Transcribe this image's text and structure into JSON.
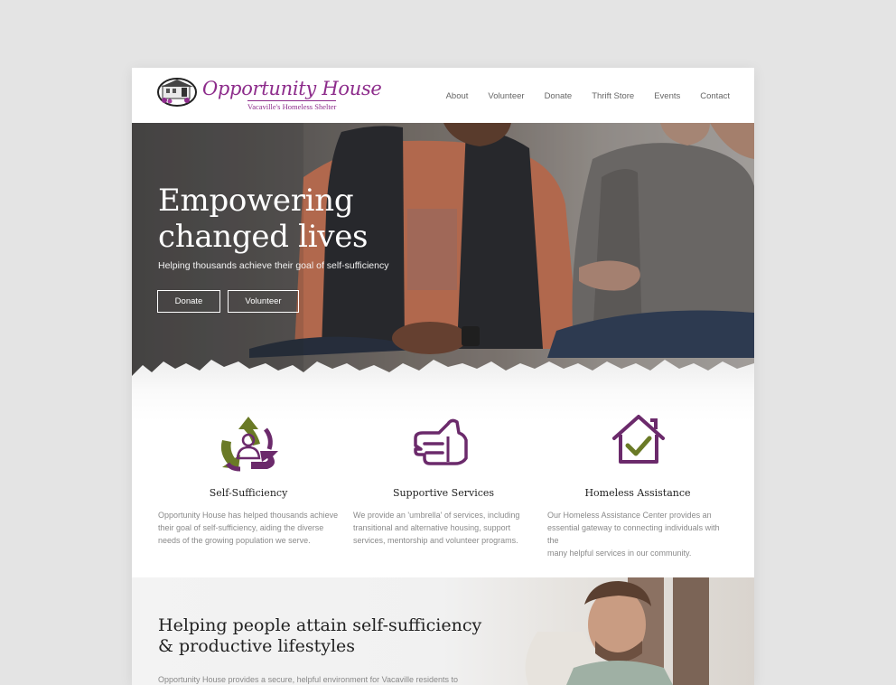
{
  "brand": {
    "name": "Opportunity House",
    "tagline": "Vacaville's Homeless Shelter",
    "accent_color": "#8d2c8b",
    "green_color": "#6a7a26"
  },
  "nav": {
    "items": [
      "About",
      "Volunteer",
      "Donate",
      "Thrift Store",
      "Events",
      "Contact"
    ]
  },
  "hero": {
    "title_line1": "Empowering",
    "title_line2": "changed lives",
    "subtitle": "Helping thousands achieve their goal of self-sufficiency",
    "donate_label": "Donate",
    "volunteer_label": "Volunteer"
  },
  "services": [
    {
      "icon": "recycle-person-icon",
      "title": "Self-Sufficiency",
      "desc": [
        "Opportunity House has helped thousands achieve",
        "their goal of self-sufficiency, aiding the diverse",
        "needs of the growing population we serve."
      ]
    },
    {
      "icon": "helping-hand-icon",
      "title": "Supportive Services",
      "desc": [
        "We provide an 'umbrella' of services, including",
        "transitional and alternative housing, support",
        "services, mentorship and volunteer programs."
      ]
    },
    {
      "icon": "house-check-icon",
      "title": "Homeless Assistance",
      "desc": [
        "Our Homeless Assistance Center provides an",
        "essential gateway to connecting individuals with the",
        "many helpful services in our community."
      ]
    }
  ],
  "lower": {
    "title_line1": "Helping people attain self-sufficiency",
    "title_line2": "& productive lifestyles",
    "body": "Opportunity House provides a secure, helpful environment for Vacaville residents to"
  }
}
